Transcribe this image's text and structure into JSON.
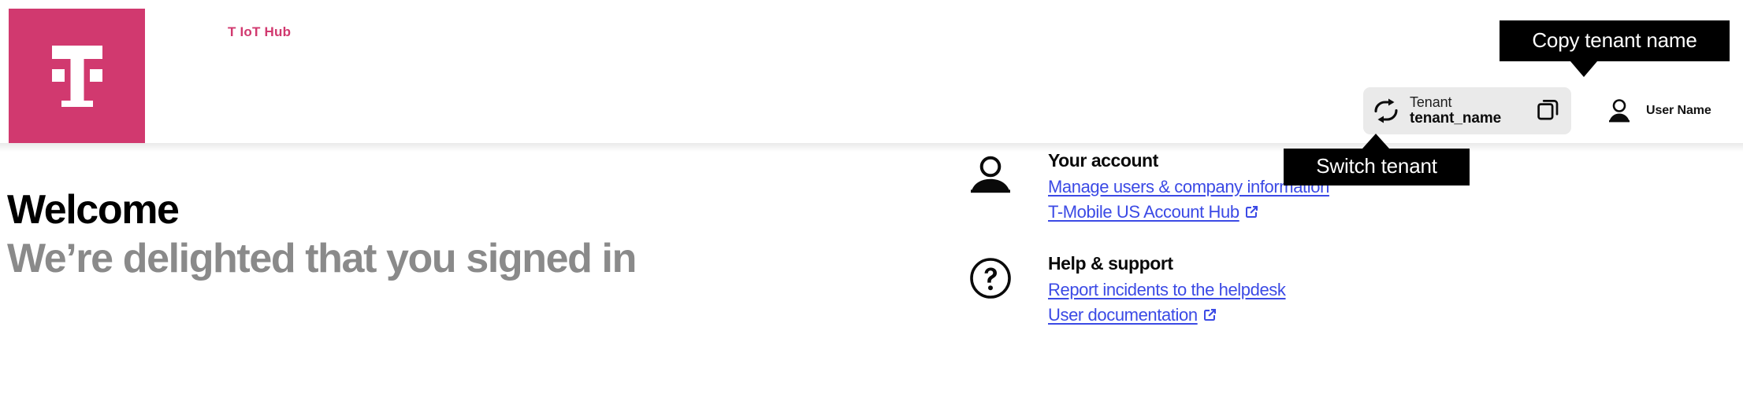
{
  "header": {
    "logo_icon": "t-mobile-logo-icon",
    "logo_bg_color": "#D1396F",
    "brand_name": "T IoT Hub",
    "brand_color": "#D1396F"
  },
  "tenant": {
    "switch_icon": "switch-arrows-icon",
    "label": "Tenant",
    "value": "tenant_name",
    "copy_icon": "copy-icon"
  },
  "user": {
    "avatar_icon": "user-avatar-icon",
    "name": "User Name"
  },
  "tooltips": {
    "copy_tenant": "Copy tenant name",
    "switch_tenant": "Switch tenant"
  },
  "main": {
    "welcome_title": "Welcome",
    "welcome_subtitle": "We’re delighted that you signed in",
    "link_color": "#3B4AE5",
    "cards": [
      {
        "icon": "person-icon",
        "heading": "Your account",
        "links": [
          {
            "label": "Manage users & company information",
            "external": false
          },
          {
            "label": "T-Mobile US Account Hub",
            "external": true,
            "external_icon": "external-link-icon"
          }
        ]
      },
      {
        "icon": "question-circle-icon",
        "heading": "Help & support",
        "links": [
          {
            "label": "Report incidents to the helpdesk",
            "external": false
          },
          {
            "label": "User documentation",
            "external": true,
            "external_icon": "external-link-icon"
          }
        ]
      }
    ]
  }
}
